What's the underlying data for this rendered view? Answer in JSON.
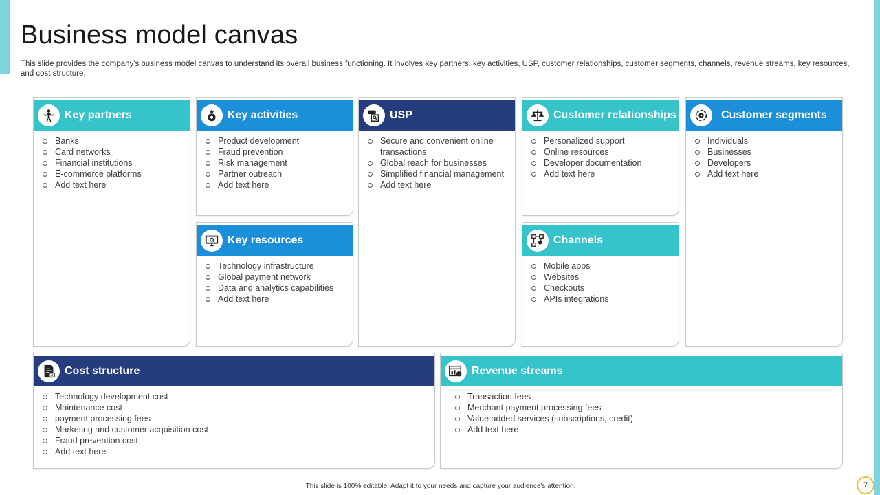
{
  "slide": {
    "title": "Business model canvas",
    "subtitle": "This slide provides the company's business model canvas to understand its overall business functioning. It involves key partners, key activities, USP, customer relationships, customer segments, channels, revenue streams, key resources, and cost structure.",
    "footer": "This slide is 100% editable. Adapt it to your needs and capture your audience's attention.",
    "page_number": "7"
  },
  "colors": {
    "teal": "#36c3c9",
    "blue": "#1b8fd9",
    "navy": "#253c7e",
    "accent": "#7fd3dc"
  },
  "cards": {
    "key_partners": {
      "title": "Key partners",
      "icon": "handshake-person-icon",
      "items": [
        "Banks",
        "Card networks",
        "Financial institutions",
        "E-commerce platforms",
        "Add text here"
      ]
    },
    "key_activities": {
      "title": "Key activities",
      "icon": "activity-gear-icon",
      "items": [
        "Product development",
        "Fraud prevention",
        "Risk management",
        "Partner outreach",
        "Add text here"
      ]
    },
    "usp": {
      "title": "USP",
      "icon": "document-search-icon",
      "items": [
        "Secure and convenient online transactions",
        "Global reach for businesses",
        "Simplified financial management",
        "Add text here"
      ]
    },
    "customer_relationships": {
      "title": "Customer relationships",
      "icon": "balance-scale-icon",
      "items": [
        "Personalized support",
        "Online resources",
        "Developer documentation",
        "Add text here"
      ]
    },
    "customer_segments": {
      "title": "Customer segments",
      "icon": "target-segments-icon",
      "items": [
        "Individuals",
        "Businesses",
        "Developers",
        "Add text here"
      ]
    },
    "key_resources": {
      "title": "Key resources",
      "icon": "monitor-search-icon",
      "items": [
        "Technology infrastructure",
        "Global payment network",
        "Data and analytics capabilities",
        "Add text here"
      ]
    },
    "channels": {
      "title": "Channels",
      "icon": "network-people-icon",
      "items": [
        "Mobile apps",
        "Websites",
        "Checkouts",
        "APIs integrations"
      ]
    },
    "cost_structure": {
      "title": "Cost structure",
      "icon": "invoice-icon",
      "items": [
        "Technology development  cost",
        "Maintenance cost",
        "payment processing fees",
        "Marketing and customer acquisition cost",
        "Fraud prevention  cost",
        "Add text here"
      ]
    },
    "revenue_streams": {
      "title": "Revenue streams",
      "icon": "revenue-chart-icon",
      "items": [
        "Transaction fees",
        "Merchant payment processing fees",
        "Value added services (subscriptions, credit)",
        "Add text here"
      ]
    }
  }
}
